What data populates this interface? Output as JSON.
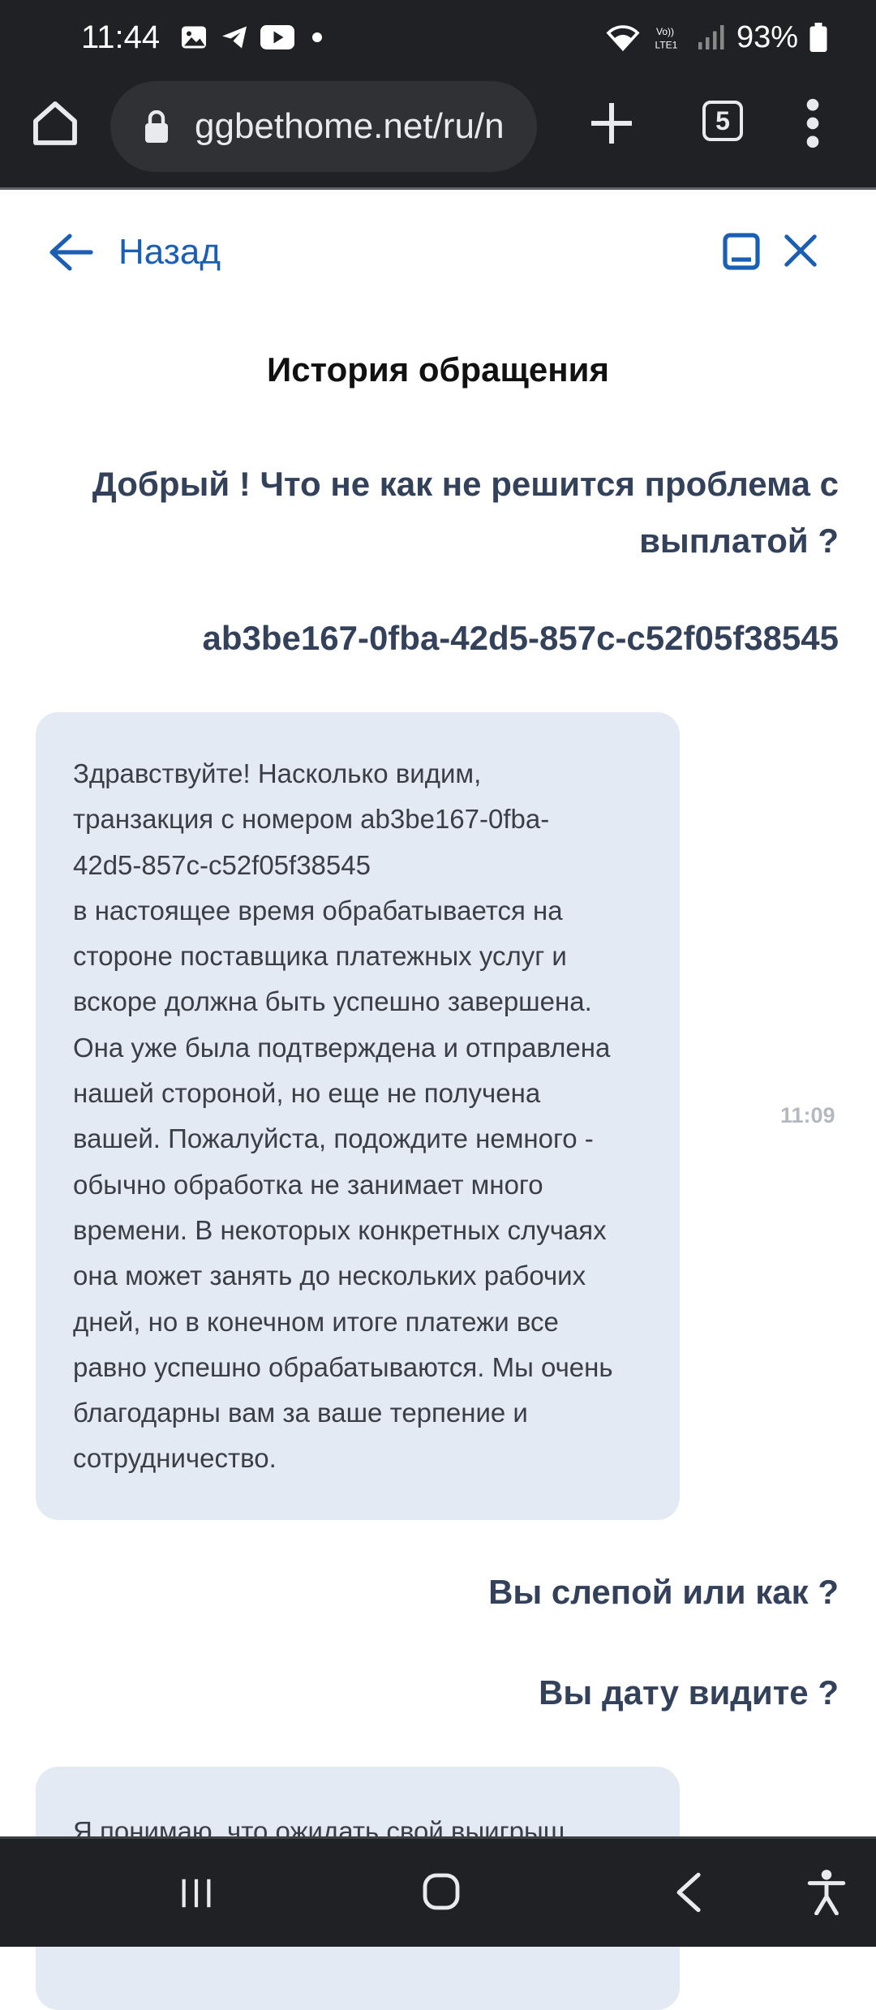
{
  "status_bar": {
    "time": "11:44",
    "battery": "93%",
    "network_label": "Vo)) LTE1"
  },
  "browser": {
    "url": "ggbethome.net/ru/n",
    "tab_count": "5"
  },
  "header": {
    "back_label": "Назад"
  },
  "page_title": "История обращения",
  "messages": {
    "user_1": "Добрый ! Что не как не решится проблема с выплатой ?",
    "user_2": "ab3be167-0fba-42d5-857c-c52f05f38545",
    "bot_1": "Здравствуйте! Насколько видим,\nтранзакция с номером ab3be167-0fba-\n42d5-857c-c52f05f38545\n в настоящее время обрабатывается на\nстороне поставщика платежных услуг и\nвскоре должна быть успешно завершена.\nОна уже была подтверждена и отправлена\nнашей стороной, но еще не получена\nвашей. Пожалуйста, подождите немного -\nобычно обработка не занимает много\nвремени. В некоторых конкретных случаях\nона может занять до нескольких рабочих\nдней, но в конечном итоге платежи все\nравно успешно обрабатываются. Мы очень\nблагодарны вам за ваше терпение и\nсотрудничество.",
    "bot_1_time": "11:09",
    "user_3": "Вы слепой или как ?",
    "user_4": "Вы дату видите ?",
    "bot_2": "Я понимаю, что ожидать свой выигрыш"
  },
  "colors": {
    "accent": "#1a5fb4",
    "user_text": "#33425a",
    "bubble_bg": "#e4eaf4",
    "chrome_bg": "#202124"
  },
  "icons": {
    "back": "arrow-left-icon",
    "minimize": "minimize-icon",
    "close": "close-icon",
    "lock": "lock-icon",
    "home": "home-icon",
    "new_tab": "plus-icon",
    "menu": "more-vert-icon"
  }
}
